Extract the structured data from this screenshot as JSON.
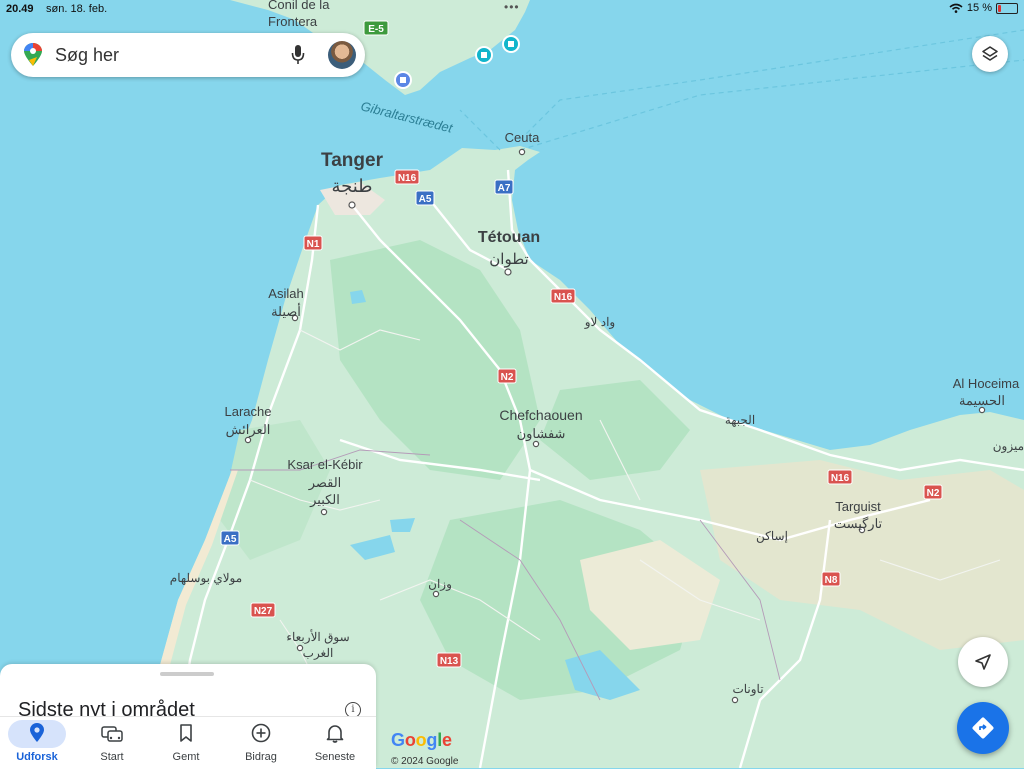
{
  "status_bar": {
    "time": "20.49",
    "date": "søn. 18. feb.",
    "battery": "15 %",
    "battery_level": 0.15
  },
  "search": {
    "placeholder": "Søg her",
    "icons": [
      "maps-pin-icon",
      "microphone-icon",
      "avatar"
    ]
  },
  "map": {
    "places": [
      {
        "id": "conil-1",
        "text": "Conil de la"
      },
      {
        "id": "conil-2",
        "text": "Frontera"
      },
      {
        "id": "ceuta",
        "text": "Ceuta"
      },
      {
        "id": "tanger",
        "text": "Tanger"
      },
      {
        "id": "tanger-ar",
        "text": "طنجة"
      },
      {
        "id": "tetouan",
        "text": "Tétouan"
      },
      {
        "id": "tetouan-ar",
        "text": "تطوان"
      },
      {
        "id": "asilah",
        "text": "Asilah"
      },
      {
        "id": "asilah-ar",
        "text": "أصيلة"
      },
      {
        "id": "oued-laou",
        "text": "واد لاو"
      },
      {
        "id": "larache",
        "text": "Larache"
      },
      {
        "id": "larache-ar",
        "text": "العرائش"
      },
      {
        "id": "chefchaouen",
        "text": "Chefchaouen"
      },
      {
        "id": "chefchaouen-ar",
        "text": "شفشاون"
      },
      {
        "id": "al-hoceima",
        "text": "Al Hoceima"
      },
      {
        "id": "al-hoceima-ar",
        "text": "الحسيمة"
      },
      {
        "id": "el-jebha",
        "text": "الجبهة"
      },
      {
        "id": "ksar-1",
        "text": "Ksar el-Kébir"
      },
      {
        "id": "ksar-ar1",
        "text": "القصر"
      },
      {
        "id": "ksar-ar2",
        "text": "الكبير"
      },
      {
        "id": "targuist",
        "text": "Targuist"
      },
      {
        "id": "targuist-ar",
        "text": "تارگيست"
      },
      {
        "id": "issaguen",
        "text": "إساكن"
      },
      {
        "id": "moulay",
        "text": "مولاي بوسلهام"
      },
      {
        "id": "ouazzane",
        "text": "وزان"
      },
      {
        "id": "souk-1",
        "text": "سوق الأربعاء"
      },
      {
        "id": "souk-2",
        "text": "الغرب"
      },
      {
        "id": "taounate",
        "text": "تاونات"
      },
      {
        "id": "nador-edge",
        "text": "ميزون"
      }
    ],
    "strait_label": "Gibraltarstrædet",
    "road_shields": [
      {
        "id": "e5",
        "text": "E-5",
        "color": "#3d9a3d"
      },
      {
        "id": "n16-a",
        "text": "N16",
        "color": "#d9534f"
      },
      {
        "id": "a5-a",
        "text": "A5",
        "color": "#3a6fc4"
      },
      {
        "id": "a7",
        "text": "A7",
        "color": "#3a6fc4"
      },
      {
        "id": "n1",
        "text": "N1",
        "color": "#d9534f"
      },
      {
        "id": "n16-b",
        "text": "N16",
        "color": "#d9534f"
      },
      {
        "id": "n2-a",
        "text": "N2",
        "color": "#d9534f"
      },
      {
        "id": "n16-c",
        "text": "N16",
        "color": "#d9534f"
      },
      {
        "id": "n2-b",
        "text": "N2",
        "color": "#d9534f"
      },
      {
        "id": "a5-b",
        "text": "A5",
        "color": "#3a6fc4"
      },
      {
        "id": "n8",
        "text": "N8",
        "color": "#d9534f"
      },
      {
        "id": "n27",
        "text": "N27",
        "color": "#d9534f"
      },
      {
        "id": "n13",
        "text": "N13",
        "color": "#d9534f"
      }
    ],
    "colors": {
      "water": "#86d6ec",
      "land": "#cdebd7",
      "green": "#b2e2c2",
      "road": "#ffffff"
    }
  },
  "controls": {
    "layers_icon": "layers-icon",
    "location_icon": "navigation-arrow-icon",
    "directions_icon": "directions-icon"
  },
  "sheet": {
    "title": "Sidste nyt i området",
    "info_icon": "i"
  },
  "tabs": [
    {
      "label": "Udforsk",
      "icon": "location-pin-icon",
      "active": true
    },
    {
      "label": "Start",
      "icon": "car-icon",
      "active": false
    },
    {
      "label": "Gemt",
      "icon": "bookmark-icon",
      "active": false
    },
    {
      "label": "Bidrag",
      "icon": "add-circle-icon",
      "active": false
    },
    {
      "label": "Seneste",
      "icon": "bell-icon",
      "active": false
    }
  ],
  "attribution": {
    "logo": "Google",
    "copyright": "© 2024 Google"
  }
}
